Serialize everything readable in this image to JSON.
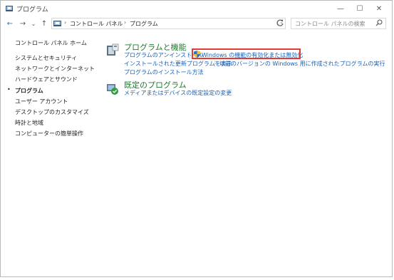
{
  "window": {
    "title": "プログラム",
    "controls": {
      "minimize": "—",
      "maximize": "☐",
      "close": "✕"
    }
  },
  "nav": {
    "back": "←",
    "forward": "→",
    "recent": "⌄",
    "up": "↑"
  },
  "breadcrumb": {
    "items": [
      "コントロール パネル",
      "プログラム"
    ]
  },
  "search": {
    "placeholder": "コントロール パネルの検索"
  },
  "sidebar": {
    "items": [
      {
        "label": "コントロール パネル ホーム",
        "current": false
      },
      {
        "label": "システムとセキュリティ",
        "current": false
      },
      {
        "label": "ネットワークとインターネット",
        "current": false
      },
      {
        "label": "ハードウェアとサウンド",
        "current": false
      },
      {
        "label": "プログラム",
        "current": true
      },
      {
        "label": "ユーザー アカウント",
        "current": false
      },
      {
        "label": "デスクトップのカスタマイズ",
        "current": false
      },
      {
        "label": "時計と地域",
        "current": false
      },
      {
        "label": "コンピューターの簡単操作",
        "current": false
      }
    ]
  },
  "sections": {
    "programs": {
      "title": "プログラムと機能",
      "links": {
        "uninstall": "プログラムのアンインストール",
        "windows_features": "Windows の機能の有効化または無効化",
        "installed_updates": "インストールされた更新プログラムを表示",
        "older_version": "以前のバージョンの Windows 用に作成されたプログラムの実行",
        "how_to_install": "プログラムのインストール方法"
      }
    },
    "defaults": {
      "title": "既定のプログラム",
      "links": {
        "change_defaults": "メディアまたはデバイスの既定設定の変更"
      }
    }
  },
  "colors": {
    "link": "#1a5fb4",
    "section_title": "#1f7a2f",
    "highlight": "#e53935"
  }
}
